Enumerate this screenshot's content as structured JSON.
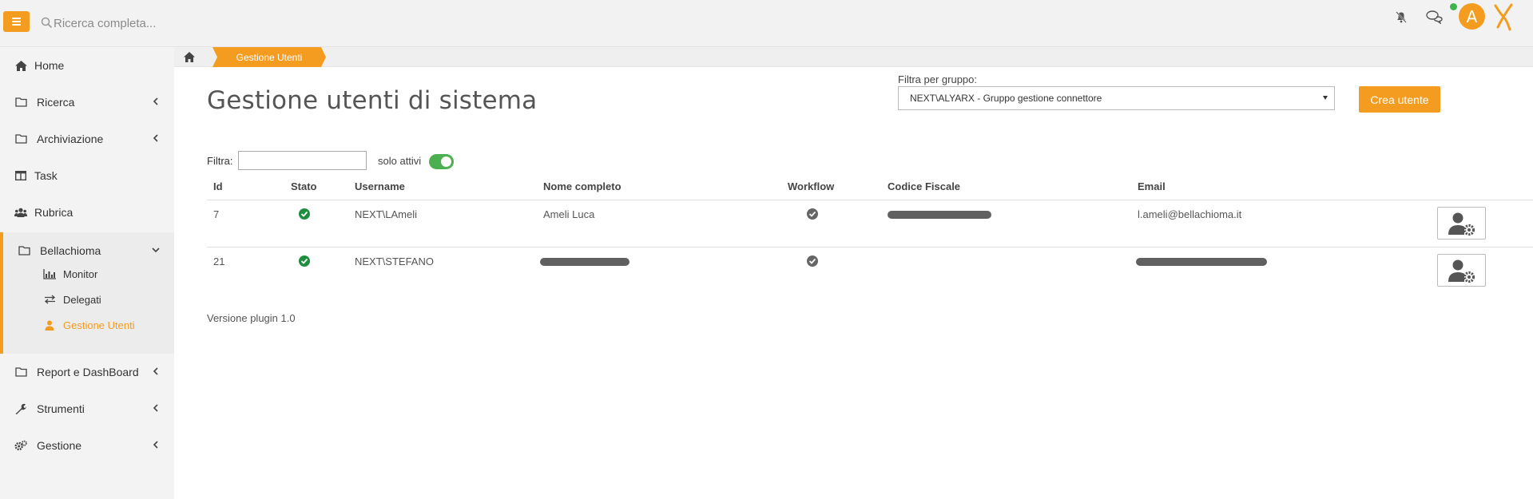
{
  "topbar": {
    "search_placeholder": "Ricerca completa...",
    "avatar_letter": "A",
    "brand_color": "#f39c1f"
  },
  "sidebar": {
    "items": [
      {
        "label": "Home",
        "icon": "home-icon"
      },
      {
        "label": "Ricerca",
        "icon": "folder-icon"
      },
      {
        "label": "Archiviazione",
        "icon": "folder-icon"
      },
      {
        "label": "Task",
        "icon": "columns-icon"
      },
      {
        "label": "Rubrica",
        "icon": "users-icon"
      },
      {
        "label": "Bellachioma",
        "icon": "folder-icon"
      },
      {
        "label": "Report e DashBoard",
        "icon": "folder-icon"
      },
      {
        "label": "Strumenti",
        "icon": "wrench-icon"
      },
      {
        "label": "Gestione",
        "icon": "gears-icon"
      }
    ],
    "subitems": [
      {
        "label": "Monitor",
        "icon": "chart-icon"
      },
      {
        "label": "Delegati",
        "icon": "exchange-icon"
      },
      {
        "label": "Gestione Utenti",
        "icon": "user-icon"
      }
    ]
  },
  "breadcrumb": {
    "current": "Gestione Utenti"
  },
  "main": {
    "title": "Gestione utenti di sistema",
    "group_filter_label": "Filtra per gruppo:",
    "group_selected": "NEXT\\ALYARX - Gruppo gestione connettore",
    "create_button": "Crea utente",
    "filter_label": "Filtra:",
    "only_active_label": "solo attivi",
    "only_active_on": true,
    "version": "Versione plugin 1.0"
  },
  "table": {
    "headers": [
      "Id",
      "Stato",
      "Username",
      "Nome completo",
      "Workflow",
      "Codice Fiscale",
      "Email"
    ],
    "rows": [
      {
        "id": "7",
        "stato": "active",
        "username": "NEXT\\LAmeli",
        "nome": "Ameli Luca",
        "workflow": true,
        "email": "l.ameli@bellachioma.it"
      },
      {
        "id": "21",
        "stato": "active",
        "username": "NEXT\\STEFANO",
        "nome": "",
        "workflow": true,
        "email": ""
      }
    ]
  }
}
